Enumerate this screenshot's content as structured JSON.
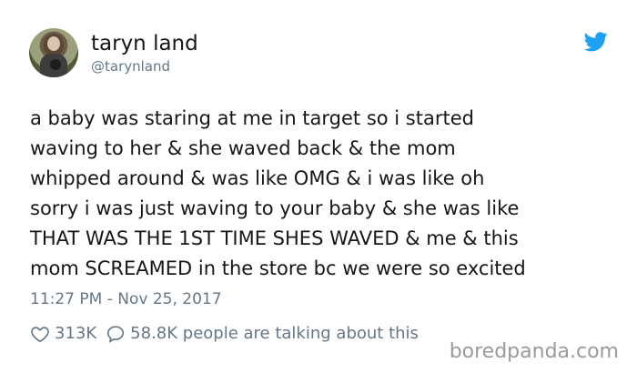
{
  "user": {
    "display_name": "taryn land",
    "handle": "@tarynland"
  },
  "tweet": {
    "text": "a baby was staring at me in target so i started\nwaving to her & she waved back & the mom\nwhipped around & was like OMG & i was like oh\nsorry i was just waving to your baby & she was like\nTHAT WAS THE 1ST TIME SHES WAVED & me & this\nmom SCREAMED in the store bc we were so excited",
    "timestamp": "11:27 PM - Nov 25, 2017"
  },
  "stats": {
    "likes": "313K",
    "talking": "58.8K people are talking about this"
  },
  "icons": {
    "bird": "twitter-bird-icon",
    "heart": "heart-icon",
    "reply": "speech-bubble-icon"
  },
  "colors": {
    "twitter_blue": "#1da1f2",
    "text": "#14171a",
    "secondary": "#657786"
  },
  "watermark": "boredpanda.com"
}
